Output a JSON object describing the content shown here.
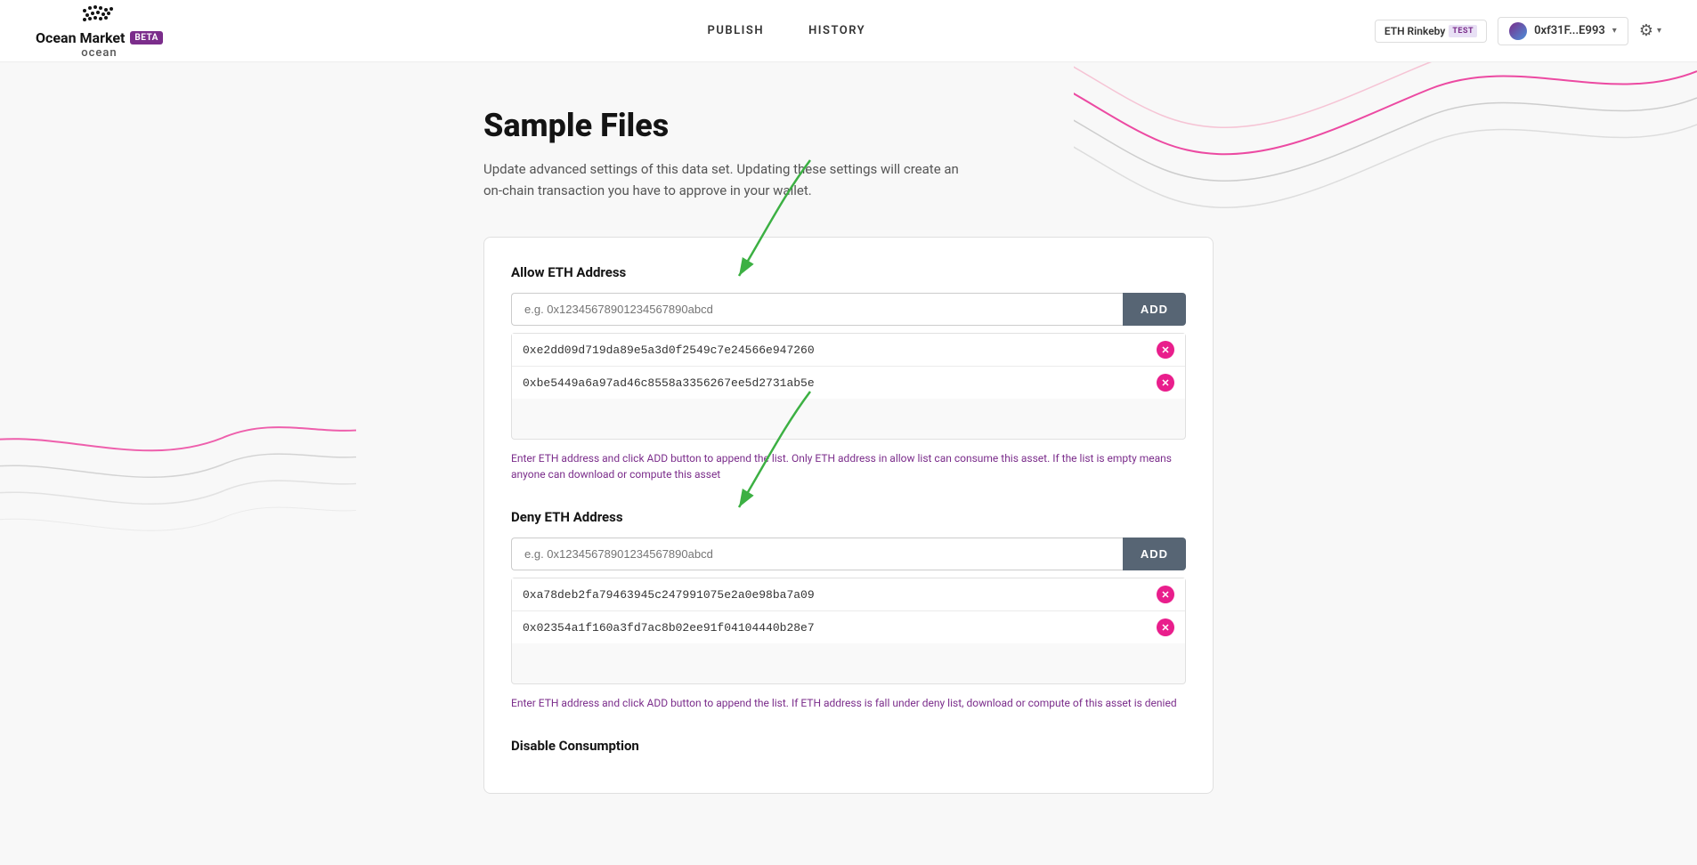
{
  "brand": {
    "market": "Ocean Market",
    "beta": "BETA",
    "ocean": "ocean"
  },
  "nav": {
    "publish": "PUBLISH",
    "history": "HISTORY"
  },
  "network": {
    "name": "ETH Rinkeby",
    "test": "TEST"
  },
  "wallet": {
    "address": "0xf31F...E993"
  },
  "page": {
    "title": "Sample Files",
    "description_line1": "Update advanced settings of this data set. Updating these settings will create an",
    "description_line2": "on-chain transaction you have to approve in your wallet."
  },
  "allow_section": {
    "label": "Allow ETH Address",
    "placeholder": "e.g. 0x12345678901234567890abcd",
    "add_button": "ADD",
    "addresses": [
      "0xe2dd09d719da89e5a3d0f2549c7e24566e947260",
      "0xbe5449a6a97ad46c8558a3356267ee5d2731ab5e"
    ],
    "help_text": "Enter ETH address and click ADD button to append the list. Only ETH address in allow list can consume this asset. If the list is empty means anyone can download or compute this asset"
  },
  "deny_section": {
    "label": "Deny ETH Address",
    "placeholder": "e.g. 0x12345678901234567890abcd",
    "add_button": "ADD",
    "addresses": [
      "0xa78deb2fa79463945c247991075e2a0e98ba7a09",
      "0x02354a1f160a3fd7ac8b02ee91f04104440b28e7"
    ],
    "help_text": "Enter ETH address and click ADD button to append the list. If ETH address is fall under deny list, download or compute of this asset is denied"
  },
  "disable_section": {
    "label": "Disable Consumption"
  }
}
